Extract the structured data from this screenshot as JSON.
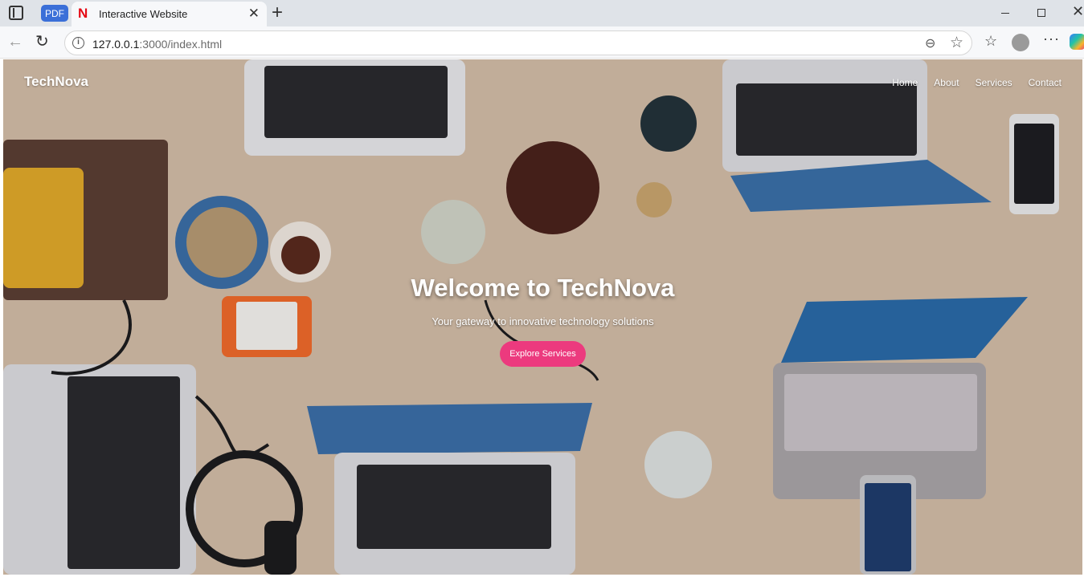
{
  "browser": {
    "pdf_tab_label": "PDF",
    "active_tab": {
      "favicon": "N",
      "title": "Interactive Website",
      "close": "✕"
    },
    "new_tab": "+",
    "address": {
      "host": "127.0.0.1",
      "path": ":3000/index.html"
    },
    "icons": {
      "back": "←",
      "reload": "↻",
      "info": "i",
      "zoom": "⊖",
      "star": "☆",
      "favorites": "☆",
      "more": "···",
      "window_close": "✕"
    }
  },
  "site": {
    "logo": "TechNova",
    "nav": [
      "Home",
      "About",
      "Services",
      "Contact"
    ],
    "hero": {
      "title": "Welcome to TechNova",
      "subtitle": "Your gateway to innovative technology solutions",
      "button": "Explore Services"
    },
    "colors": {
      "accent": "#ec3a7e",
      "text": "#ffffff"
    }
  }
}
